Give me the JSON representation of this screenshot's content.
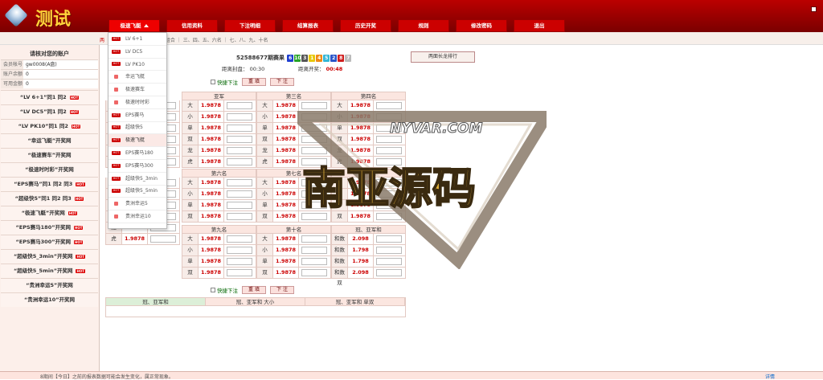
{
  "header": {
    "logo_text": "测试",
    "nav": [
      {
        "label": "极速飞艇",
        "active": true
      },
      {
        "label": "信用资料"
      },
      {
        "label": "下注明细"
      },
      {
        "label": "结算报表"
      },
      {
        "label": "历史开奖"
      },
      {
        "label": "规则"
      },
      {
        "label": "修改密码"
      },
      {
        "label": "退出"
      }
    ]
  },
  "subbar": {
    "left_text": "两",
    "groups_text": "军 组合 ｜ 三、四、五、六名 ｜ 七、八、九、十名"
  },
  "sidebar": {
    "title": "请核对您的账户",
    "info": [
      {
        "label": "会员帐号",
        "value": "gw0008(A盘)"
      },
      {
        "label": "账户余额",
        "value": "0"
      },
      {
        "label": "可用金额",
        "value": "0"
      }
    ],
    "lotteries": [
      {
        "label": "“LV 6+1”同1 同2",
        "hot": true
      },
      {
        "label": "“LV DC5”同1 同2",
        "hot": true
      },
      {
        "label": "“LV PK10”同1 同2",
        "hot": true
      },
      {
        "label": "“幸运飞艇”开奖网",
        "hot": false
      },
      {
        "label": "“极速赛车”开奖网",
        "hot": false
      },
      {
        "label": "“极速时时彩”开奖网",
        "hot": false
      },
      {
        "label": "“EPS赛马”同1 同2 同3",
        "hot": true
      },
      {
        "label": "“超级快5”同1 同2 同3",
        "hot": true
      },
      {
        "label": "“极速飞艇”开奖网",
        "hot": true
      },
      {
        "label": "“EPS赛马180”开奖网",
        "hot": true
      },
      {
        "label": "“EPS赛马300”开奖网",
        "hot": true
      },
      {
        "label": "“超级快5_3min”开奖网",
        "hot": true
      },
      {
        "label": "“超级快5_5min”开奖网",
        "hot": true
      },
      {
        "label": "“贵洲幸运5”开奖网",
        "hot": false
      },
      {
        "label": "“贵洲幸运10”开奖网",
        "hot": false
      }
    ],
    "hot_badge": "HOT"
  },
  "dropdown": [
    {
      "label": "LV 6+1",
      "icon": "hot"
    },
    {
      "label": "LV DC5",
      "icon": "hot"
    },
    {
      "label": "LV PK10",
      "icon": "hot"
    },
    {
      "label": "幸运飞艇",
      "icon": "sq"
    },
    {
      "label": "极速赛车",
      "icon": "sq"
    },
    {
      "label": "极速时时彩",
      "icon": "sq"
    },
    {
      "label": "EPS赛马",
      "icon": "hot"
    },
    {
      "label": "超级快5",
      "icon": "hot"
    },
    {
      "label": "极速飞艇",
      "icon": "hot",
      "active": true
    },
    {
      "label": "EPS赛马180",
      "icon": "hot"
    },
    {
      "label": "EPS赛马300",
      "icon": "hot"
    },
    {
      "label": "超级快5_3min",
      "icon": "hot"
    },
    {
      "label": "超级快5_5min",
      "icon": "hot"
    },
    {
      "label": "贵洲幸运5",
      "icon": "sq"
    },
    {
      "label": "贵洲幸运10",
      "icon": "sq"
    }
  ],
  "main": {
    "round_label": "52588677期赛果",
    "balls": [
      {
        "n": "6",
        "color": "#1f3fd0"
      },
      {
        "n": "10",
        "color": "#27a327"
      },
      {
        "n": "3",
        "color": "#555555"
      },
      {
        "n": "1",
        "color": "#e7c80a"
      },
      {
        "n": "4",
        "color": "#f08a15"
      },
      {
        "n": "5",
        "color": "#33b6d6"
      },
      {
        "n": "2",
        "color": "#2a55c8"
      },
      {
        "n": "8",
        "color": "#d01e1e"
      },
      {
        "n": "7",
        "color": "#bbbbbb"
      }
    ],
    "rank_button": "两面长龙排行",
    "close_label": "距离封盘：",
    "close_value": "00:30",
    "open_label": "距离开奖：",
    "open_value": "00:48",
    "quick_label": "快捷下注",
    "reset": "重 填",
    "submit": "下 注",
    "odds": "1.9878",
    "odds_b": "2.098",
    "odds_c": "1.798",
    "group_headers_row1": [
      "亚军",
      "第三名",
      "第四名"
    ],
    "group_headers_row2": [
      "第六名",
      "第七名",
      "第八名"
    ],
    "group_headers_row3": [
      "第九名",
      "第十名",
      "冠、亚军和"
    ],
    "row_labels": [
      "大",
      "小",
      "单",
      "双",
      "龙",
      "虎"
    ],
    "sum_labels": [
      "和数大",
      "和数小",
      "和数单",
      "和数双"
    ],
    "bottom_tabs": [
      "冠、亚军和",
      "冠、亚军和 大小",
      "冠、亚军和 单双"
    ]
  },
  "footer": {
    "text": "8期间【今日】之前的报表数据可能会发生变化，属正常现象。",
    "link": "详情"
  },
  "watermark": {
    "top": "NYVAR.COM",
    "bottom": "南亚源码"
  }
}
